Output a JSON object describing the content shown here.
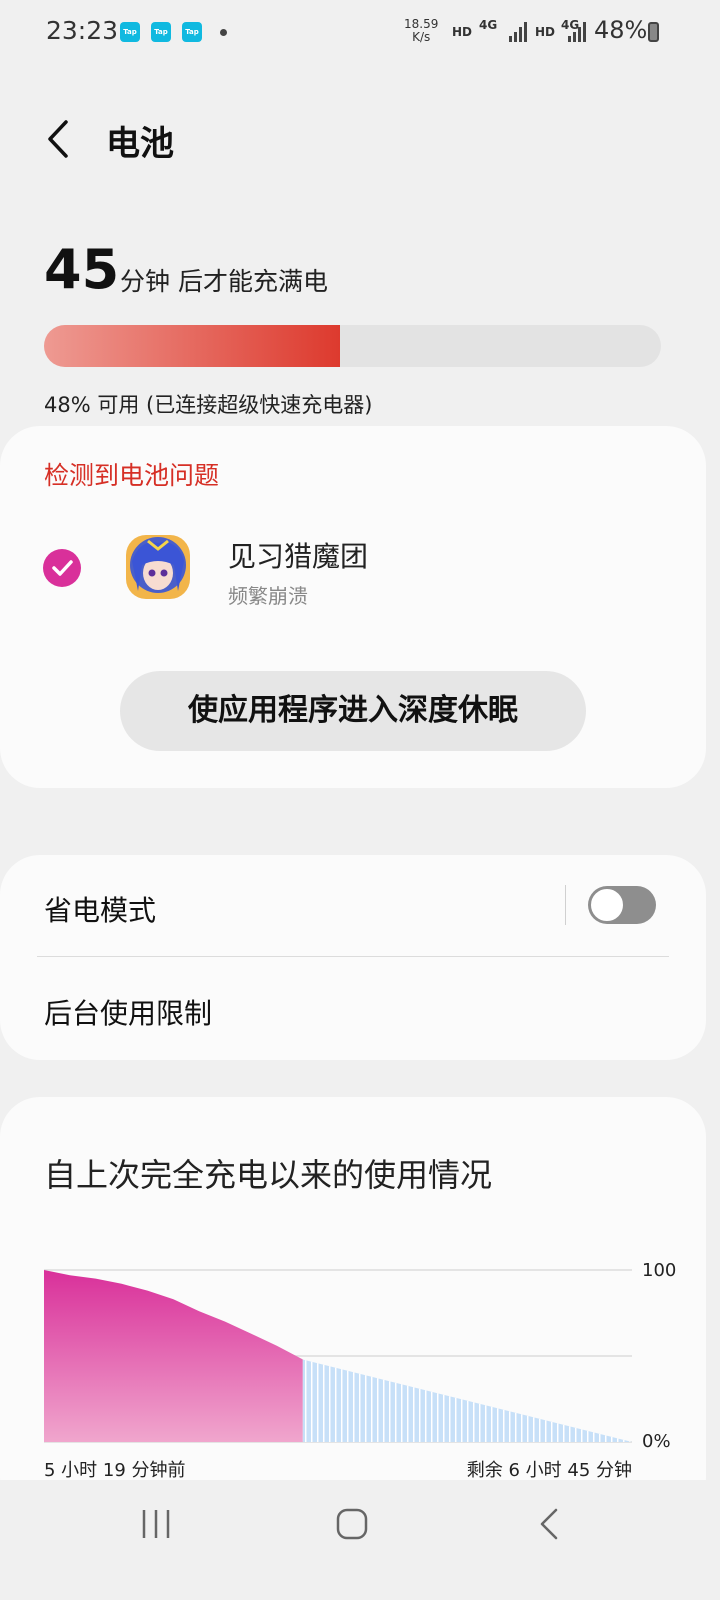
{
  "status_bar": {
    "time": "23:23",
    "notification_icons": [
      "Tap",
      "Tap",
      "Tap"
    ],
    "net_speed_value": "18.59",
    "net_speed_unit": "K/s",
    "hd1": "HD",
    "net1": "4G",
    "hd2": "HD",
    "net2": "4G",
    "battery_percent": "48%"
  },
  "header": {
    "title": "电池"
  },
  "charge": {
    "minutes": "45",
    "text": "分钟 后才能充满电",
    "level_percent": 48,
    "status": "48% 可用 (已连接超级快速充电器)",
    "bar_gradient_start": "#ee9a92",
    "bar_gradient_end": "#dd3a2e"
  },
  "issues": {
    "title": "检测到电池问题",
    "app_name": "见习猎魔团",
    "app_issue": "频繁崩溃",
    "app_checked": true,
    "action_label": "使应用程序进入深度休眠"
  },
  "settings": {
    "power_saving_label": "省电模式",
    "power_saving_on": false,
    "background_limits_label": "后台使用限制"
  },
  "usage": {
    "title": "自上次完全充电以来的使用情况"
  },
  "chart_data": {
    "type": "area",
    "y_tick_top": "100",
    "y_tick_bottom": "0%",
    "x_label_left": "5 小时 19 分钟前",
    "x_label_right": "剩余 6 小时 45 分钟",
    "ylim": [
      0,
      100
    ],
    "history": {
      "x": [
        0,
        0.1,
        0.2,
        0.3,
        0.4,
        0.5,
        0.6,
        0.7,
        0.8,
        0.9,
        1.0
      ],
      "y": [
        100,
        97,
        95,
        92,
        88,
        83,
        76,
        70,
        63,
        56,
        48
      ]
    },
    "projection": {
      "start": 48,
      "end": 0
    },
    "history_fraction": 0.44,
    "history_color": "#d9309a",
    "projection_color": "#b9d8f7"
  },
  "nav": {
    "icons": [
      "recents-icon",
      "home-icon",
      "back-icon"
    ]
  }
}
